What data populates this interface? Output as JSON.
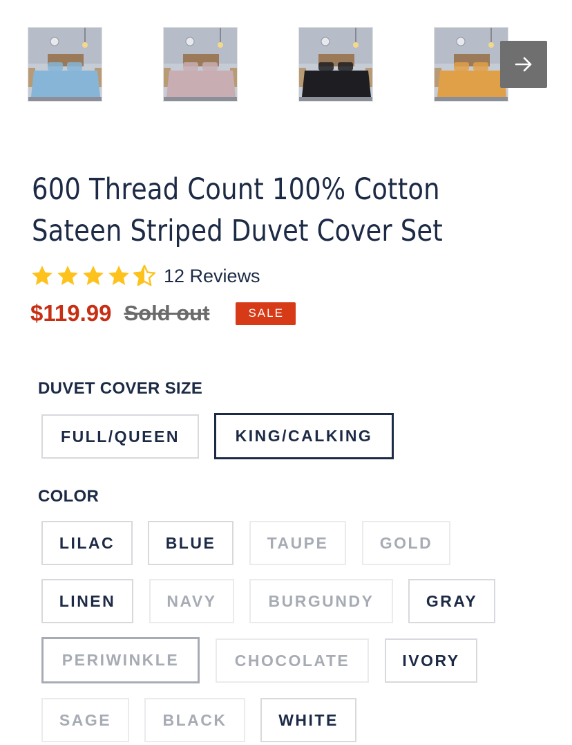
{
  "gallery": {
    "thumbnails": [
      {
        "name": "blue-bedding-thumbnail",
        "color": "#86b5d8"
      },
      {
        "name": "lilac-bedding-thumbnail",
        "color": "#c8aeb3"
      },
      {
        "name": "black-bedding-thumbnail",
        "color": "#1e1e22"
      },
      {
        "name": "gold-bedding-thumbnail",
        "color": "#e0a048"
      }
    ],
    "next_icon": "arrow-right-icon"
  },
  "product": {
    "title_line1": "600 Thread Count 100% Cotton",
    "title_line2": "Sateen Striped Duvet Cover Set",
    "rating": 4.5,
    "rating_max": 5,
    "reviews_label": "12 Reviews",
    "price": "$119.99",
    "compare_price": "Sold out",
    "badge": "SALE"
  },
  "options": {
    "size_label": "DUVET COVER SIZE",
    "sizes": [
      {
        "label": "FULL/QUEEN",
        "state": "available"
      },
      {
        "label": "KING/CALKING",
        "state": "selected"
      }
    ],
    "color_label": "COLOR",
    "colors": [
      {
        "label": "LILAC",
        "state": "available"
      },
      {
        "label": "BLUE",
        "state": "available"
      },
      {
        "label": "TAUPE",
        "state": "disabled"
      },
      {
        "label": "GOLD",
        "state": "disabled"
      },
      {
        "label": "LINEN",
        "state": "available"
      },
      {
        "label": "NAVY",
        "state": "disabled"
      },
      {
        "label": "BURGUNDY",
        "state": "disabled"
      },
      {
        "label": "GRAY",
        "state": "available"
      },
      {
        "label": "PERIWINKLE",
        "state": "focused-disabled"
      },
      {
        "label": "CHOCOLATE",
        "state": "disabled"
      },
      {
        "label": "IVORY",
        "state": "available"
      },
      {
        "label": "SAGE",
        "state": "disabled"
      },
      {
        "label": "BLACK",
        "state": "disabled"
      },
      {
        "label": "WHITE",
        "state": "available"
      }
    ]
  },
  "colors": {
    "text": "#1c2a45",
    "price": "#c72f14",
    "sale_badge": "#d63a17",
    "star": "#fdc21b"
  }
}
